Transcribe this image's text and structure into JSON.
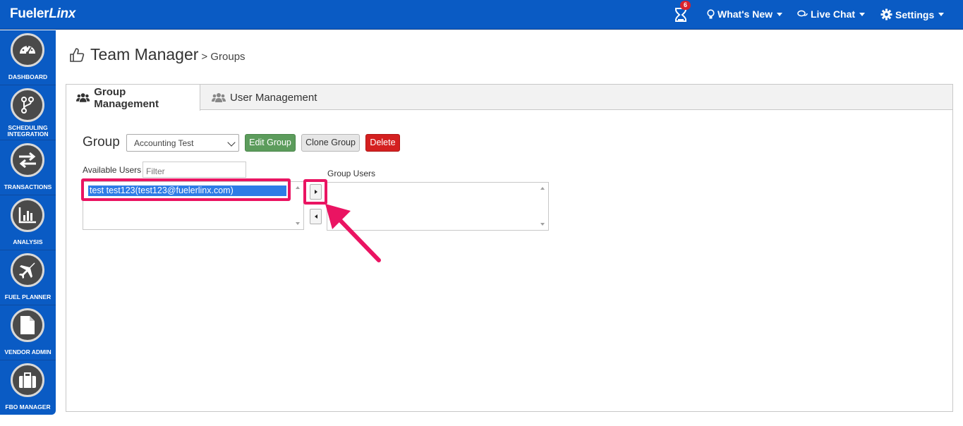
{
  "header": {
    "brand_part1": "Fueler",
    "brand_part2": "Linx",
    "notification_count": "6",
    "whats_new": "What's New",
    "live_chat": "Live Chat",
    "settings": "Settings"
  },
  "sidebar": {
    "items": [
      {
        "label": "DASHBOARD",
        "icon": "speedometer-icon"
      },
      {
        "label": "SCHEDULING INTEGRATION",
        "icon": "branch-icon"
      },
      {
        "label": "TRANSACTIONS",
        "icon": "swap-arrows-icon"
      },
      {
        "label": "ANALYSIS",
        "icon": "bar-chart-icon"
      },
      {
        "label": "FUEL PLANNER",
        "icon": "airplane-icon"
      },
      {
        "label": "VENDOR ADMIN",
        "icon": "document-icon"
      },
      {
        "label": "FBO MANAGER",
        "icon": "briefcase-icon"
      }
    ]
  },
  "page": {
    "title": "Team Manager",
    "breadcrumb": "> Groups"
  },
  "tabs": [
    {
      "label": "Group Management",
      "active": true
    },
    {
      "label": "User Management",
      "active": false
    }
  ],
  "group_form": {
    "group_label": "Group",
    "selected_group": "Accounting Test",
    "edit_button": "Edit Group",
    "clone_button": "Clone Group",
    "delete_button": "Delete",
    "available_users_label": "Available Users",
    "filter_placeholder": "Filter",
    "group_users_label": "Group Users",
    "available_users": [
      "test test123(test123@fuelerlinx.com)"
    ],
    "group_users": []
  },
  "colors": {
    "brand_blue": "#0a5bc4",
    "highlight_pink": "#ea1462",
    "edit_green": "#5c9c5c",
    "delete_red": "#d42020"
  }
}
